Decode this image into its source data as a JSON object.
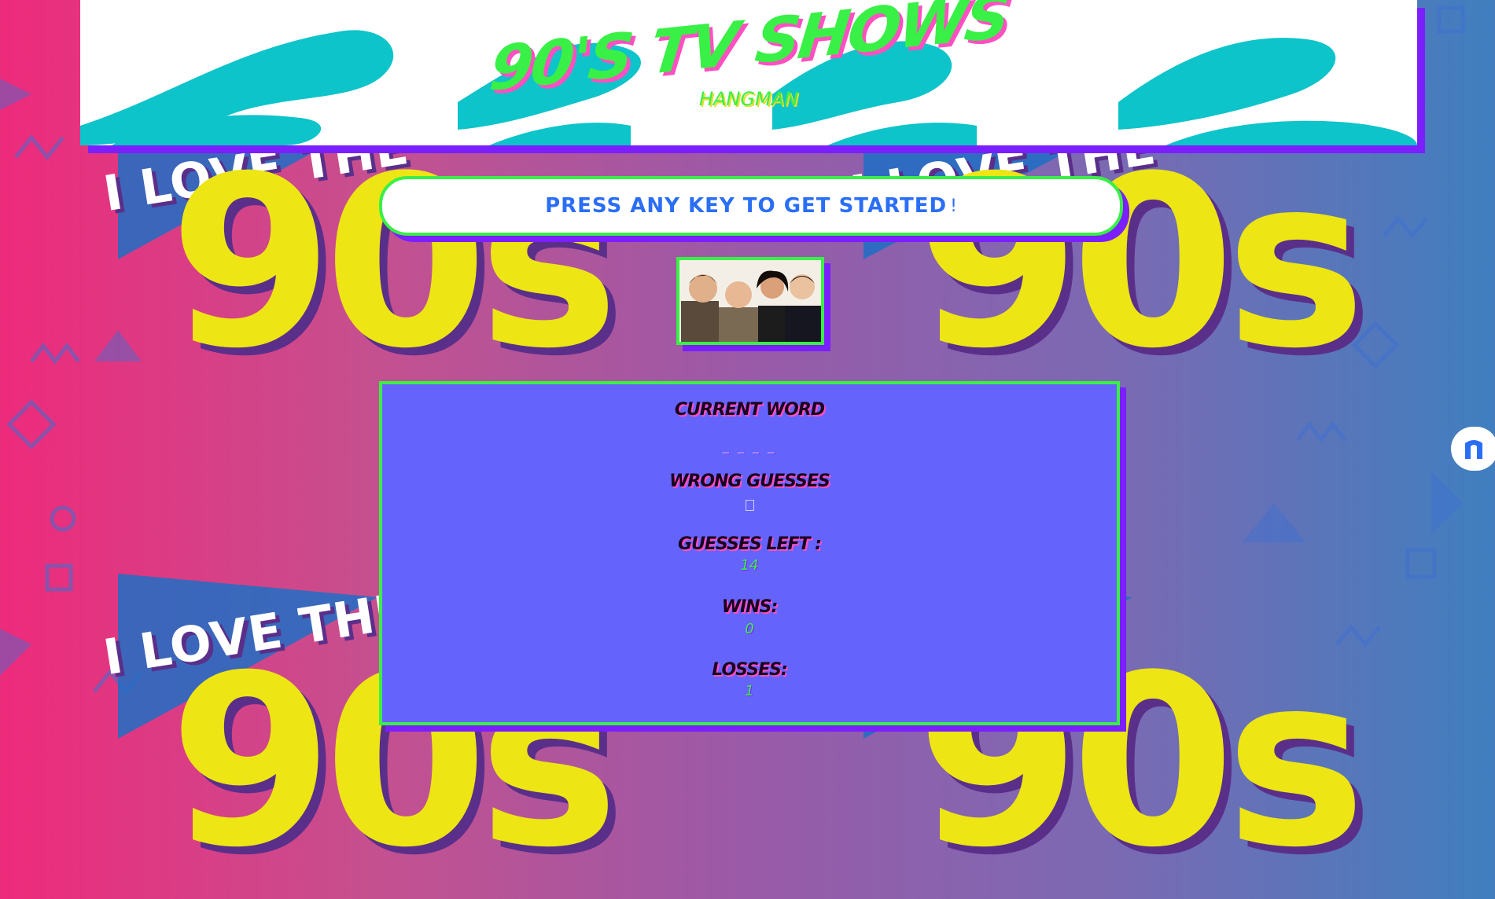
{
  "header": {
    "title": "90'S TV SHOWS",
    "subtitle": "HANGMAN"
  },
  "banner": {
    "text": "PRESS ANY KEY TO GET STARTED",
    "suffix": "!"
  },
  "background": {
    "slogan_top": "I LOVE THE",
    "decade": "90s"
  },
  "stats": {
    "current_word_label": "CURRENT WORD",
    "current_word_value": "_ _ _ _",
    "wrong_guesses_label": "WRONG GUESSES",
    "guesses_left_label": "GUESSES LEFT :",
    "guesses_left_value": "14",
    "wins_label": "WINS:",
    "wins_value": "0",
    "losses_label": "LOSSES:",
    "losses_value": "1"
  },
  "colors": {
    "accent_green": "#39f046",
    "accent_purple": "#7b1fff",
    "accent_pink": "#ff4fc1",
    "panel_blue": "#6464fd",
    "decade_yellow": "#ede514"
  },
  "icons": {
    "side_widget": "n-logo-icon"
  }
}
